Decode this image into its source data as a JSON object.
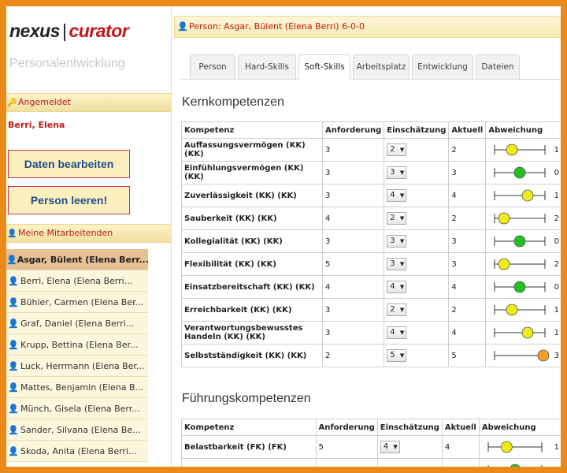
{
  "logo": {
    "part1": "nexus",
    "separator": "|",
    "part2": "curator"
  },
  "subtitle": "Personalentwicklung",
  "sidebar": {
    "logged_in_label": "Angemeldet",
    "user_name": "Berri, Elena",
    "edit_button": "Daten bearbeiten",
    "clear_button": "Person leeren!",
    "employees_label": "Meine Mitarbeitenden",
    "employees": [
      "Asgar, Bülent (Elena Berr...",
      "Berri, Elena (Elena Berri...",
      "Bühler, Carmen (Elena Ber...",
      "Graf, Daniel (Elena Berri...",
      "Krupp, Bettina (Elena Ber...",
      "Luck, Herrmann (Elena Ber...",
      "Mattes, Benjamin (Elena B...",
      "Münch, Gisela (Elena Berr...",
      "Sander, Silvana (Elena Be...",
      "Skoda, Anita (Elena Berri..."
    ]
  },
  "person_bar": "Person: Asgar, Bülent (Elena Berri) 6-0-0",
  "tabs": [
    "Person",
    "Hard-Skills",
    "Soft-Skills",
    "Arbeitsplatz",
    "Entwicklung",
    "Dateien"
  ],
  "active_tab": 2,
  "colors": {
    "frame": "#ea8a1b",
    "brand_red": "#c0171d",
    "green": "#22c022",
    "yellow": "#f2ea16",
    "orange": "#f0a020"
  },
  "kern": {
    "title": "Kernkompetenzen",
    "headers": [
      "Kompetenz",
      "Anforderung",
      "Einschätzung",
      "Aktuell",
      "Abweichung"
    ],
    "rows": [
      {
        "name": "Auffassungsvermögen (KK) (KK)",
        "req": "3",
        "est": "2",
        "cur": "2",
        "dev": "1",
        "offset": -1,
        "color": "yellow"
      },
      {
        "name": "Einfühlungsvermögen (KK) (KK)",
        "req": "3",
        "est": "3",
        "cur": "3",
        "dev": "0",
        "offset": 0,
        "color": "green"
      },
      {
        "name": "Zuverlässigkeit (KK) (KK)",
        "req": "3",
        "est": "4",
        "cur": "4",
        "dev": "1",
        "offset": 1,
        "color": "yellow"
      },
      {
        "name": "Sauberkeit (KK) (KK)",
        "req": "4",
        "est": "2",
        "cur": "2",
        "dev": "2",
        "offset": -2,
        "color": "yellow"
      },
      {
        "name": "Kollegialität (KK) (KK)",
        "req": "3",
        "est": "3",
        "cur": "3",
        "dev": "0",
        "offset": 0,
        "color": "green"
      },
      {
        "name": "Flexibilität (KK) (KK)",
        "req": "5",
        "est": "3",
        "cur": "3",
        "dev": "2",
        "offset": -2,
        "color": "yellow"
      },
      {
        "name": "Einsatzbereitschaft (KK) (KK)",
        "req": "4",
        "est": "4",
        "cur": "4",
        "dev": "0",
        "offset": 0,
        "color": "green"
      },
      {
        "name": "Erreichbarkeit (KK) (KK)",
        "req": "3",
        "est": "2",
        "cur": "2",
        "dev": "1",
        "offset": -1,
        "color": "yellow"
      },
      {
        "name": "Verantwortungsbewusstes Handeln (KK) (KK)",
        "req": "3",
        "est": "4",
        "cur": "4",
        "dev": "1",
        "offset": 1,
        "color": "yellow"
      },
      {
        "name": "Selbstständigkeit (KK) (KK)",
        "req": "2",
        "est": "5",
        "cur": "5",
        "dev": "3",
        "offset": 3,
        "color": "orange"
      }
    ]
  },
  "fuehrung": {
    "title": "Führungskompetenzen",
    "headers": [
      "Kompetenz",
      "Anforderung",
      "Einschätzung",
      "Aktuell",
      "Abweichung"
    ],
    "rows": [
      {
        "name": "Belastbarkeit (FK) (FK)",
        "req": "5",
        "est": "4",
        "cur": "4",
        "dev": "1",
        "offset": -1,
        "color": "yellow"
      },
      {
        "name": "",
        "req": "",
        "est": "",
        "cur": "",
        "dev": "",
        "offset": 0,
        "color": "green"
      }
    ]
  }
}
